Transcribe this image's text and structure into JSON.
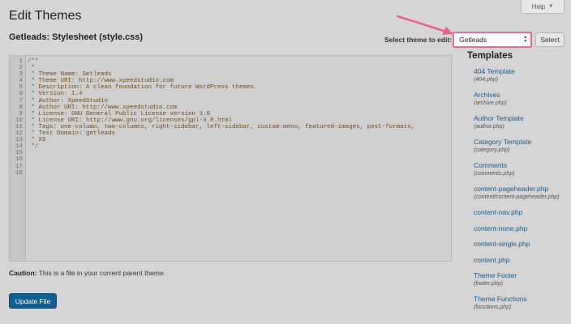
{
  "page": {
    "title": "Edit Themes",
    "help_label": "Help",
    "file_heading": "Getleads: Stylesheet (style.css)"
  },
  "theme_selector": {
    "label": "Select theme to edit:",
    "selected": "Getleads",
    "button_label": "Select"
  },
  "editor": {
    "lines": [
      "/**",
      " *",
      " * Theme Name: Getleads",
      " * Theme URI: http://www.xpeedstudio.com",
      " * Description: A clean foundation for future WordPress themes.",
      " * Version: 1.4",
      " * Author: XpeedStudio",
      " * Author URI: http://www.xpeedstudio.com",
      " * License: GNU General Public License version 3.0",
      " * License URI: http://www.gnu.org/licenses/gpl-3.0.html",
      " * Tags: one-column, two-columns, right-sidebar, left-sidebar, custom-menu, featured-images, post-formats,",
      " * Text Domain: getleads",
      " * XS",
      " */",
      "",
      "",
      "",
      ""
    ]
  },
  "caution": {
    "label": "Caution:",
    "text": " This is a file in your current parent theme."
  },
  "update_button_label": "Update File",
  "templates": {
    "heading": "Templates",
    "items": [
      {
        "label": "404 Template",
        "file": "(404.php)"
      },
      {
        "label": "Archives",
        "file": "(archive.php)"
      },
      {
        "label": "Author Template",
        "file": "(author.php)"
      },
      {
        "label": "Category Template",
        "file": "(category.php)"
      },
      {
        "label": "Comments",
        "file": "(comments.php)"
      },
      {
        "label": "content-pageheader.php",
        "file": "(content/content-pageheader.php)"
      },
      {
        "label": "content-nav.php",
        "file": ""
      },
      {
        "label": "content-none.php",
        "file": ""
      },
      {
        "label": "content-single.php",
        "file": ""
      },
      {
        "label": "content.php",
        "file": ""
      },
      {
        "label": "Theme Footer",
        "file": "(footer.php)"
      },
      {
        "label": "Theme Functions",
        "file": "(functions.php)"
      }
    ]
  },
  "colors": {
    "accent_link": "#1a5d8c",
    "primary_button": "#0e5e92",
    "annotation": "#e8658a"
  }
}
